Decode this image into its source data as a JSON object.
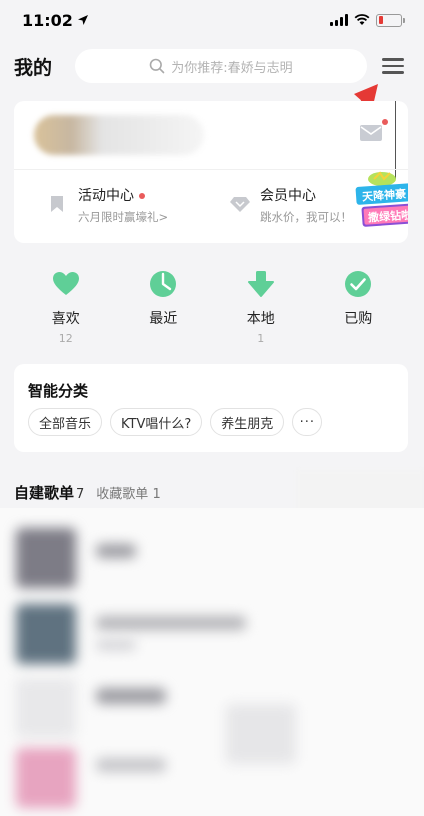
{
  "status_bar": {
    "time": "11:02",
    "battery_level": 0.2,
    "battery_color": "#e53935"
  },
  "header": {
    "title": "我的",
    "search_placeholder": "为你推荐:春娇与志明",
    "search_icon": "search-icon",
    "menu_icon": "hamburger-menu-icon"
  },
  "profile_card": {
    "mail_icon": "mail-icon",
    "entries": [
      {
        "title": "活动中心",
        "subtitle": "六月限时赢壕礼>",
        "icon": "bookmark-icon",
        "has_dot": true
      },
      {
        "title": "会员中心",
        "subtitle": "跳水价，我可以！",
        "icon": "diamond-icon",
        "has_dot": false
      }
    ],
    "vip_badge": {
      "line1": "天降神豪",
      "line2": "撒绿钻啦"
    }
  },
  "quick_actions": [
    {
      "label": "喜欢",
      "count": "12",
      "icon": "heart-icon"
    },
    {
      "label": "最近",
      "count": "",
      "icon": "clock-icon"
    },
    {
      "label": "本地",
      "count": "1",
      "icon": "download-icon"
    },
    {
      "label": "已购",
      "count": "",
      "icon": "check-icon"
    }
  ],
  "smart_category": {
    "title": "智能分类",
    "chips": [
      "全部音乐",
      "KTV唱什么?",
      "养生朋克"
    ],
    "more_label": "···"
  },
  "playlists": {
    "created_label": "自建歌单",
    "created_count": "7",
    "collected_label": "收藏歌单",
    "collected_count": "1"
  },
  "colors": {
    "accent_green": "#5fcf97",
    "annotation_red": "#e53935",
    "background": "#f4f4f6"
  }
}
